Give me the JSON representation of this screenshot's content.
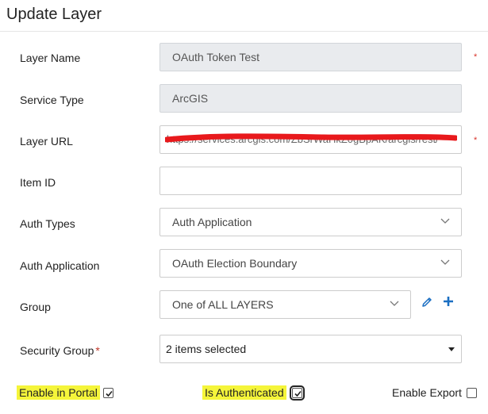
{
  "header": {
    "title": "Update Layer"
  },
  "form": {
    "layer_name": {
      "label": "Layer Name",
      "value": "OAuth Token Test",
      "required_mark": "*"
    },
    "service_type": {
      "label": "Service Type",
      "value": "ArcGIS"
    },
    "layer_url": {
      "label": "Layer URL",
      "value": "https://services.arcgis.com/ZbSrWaHkZ0gBpAK/arcgis/rest/",
      "required_mark": "*",
      "redaction_color": "#e8191c"
    },
    "item_id": {
      "label": "Item ID",
      "value": ""
    },
    "auth_types": {
      "label": "Auth Types",
      "value": "Auth Application"
    },
    "auth_application": {
      "label": "Auth Application",
      "value": "OAuth Election Boundary"
    },
    "group": {
      "label": "Group",
      "value": "One of ALL LAYERS"
    },
    "security_group": {
      "label": "Security Group",
      "required_mark": "*",
      "value": "2 items selected"
    },
    "enable_in_portal": {
      "label": "Enable in Portal",
      "checked": true
    },
    "is_authenticated": {
      "label": "Is Authenticated",
      "checked": true
    },
    "enable_export": {
      "label": "Enable Export",
      "checked": false
    }
  },
  "colors": {
    "accent": "#1b6fc2",
    "required": "#d9342b",
    "highlight": "#f5f53a",
    "disabled_bg": "#e9ebee"
  },
  "icons": {
    "edit": "pencil-icon",
    "add": "plus-icon",
    "dropdown": "chevron-down-icon"
  }
}
